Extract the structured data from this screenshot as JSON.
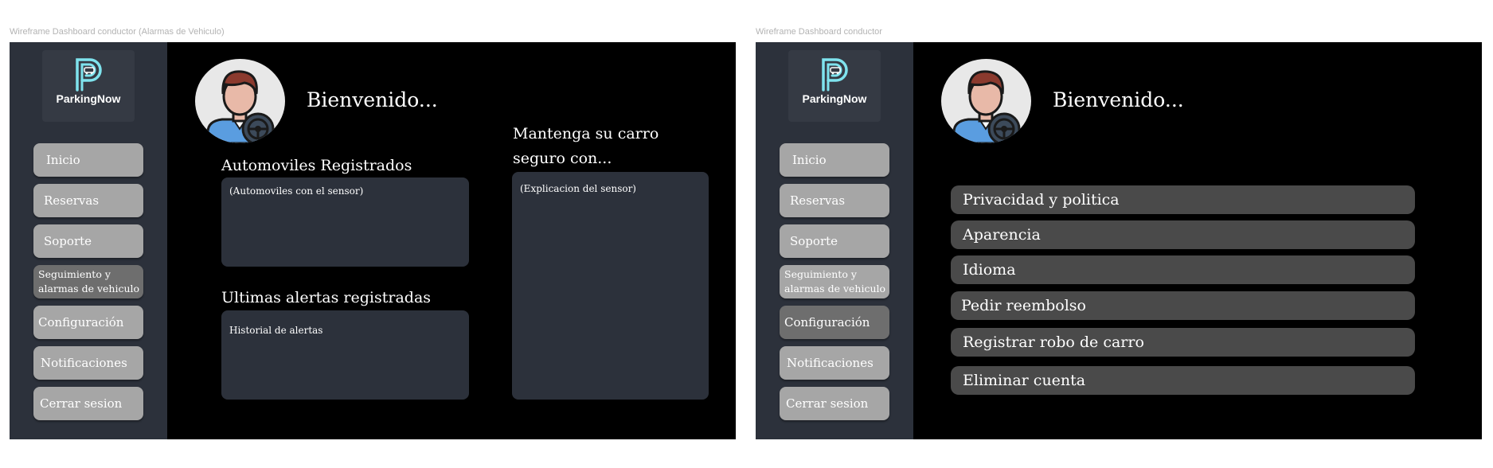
{
  "frames": [
    {
      "title": "Wireframe Dashboard conductor (Alarmas de Vehiculo)",
      "logo_text": "ParkingNow",
      "nav": [
        {
          "label": "Inicio"
        },
        {
          "label": "Reservas"
        },
        {
          "label": "Soporte"
        },
        {
          "label": "Seguimiento y alarmas de vehiculo",
          "active": true
        },
        {
          "label": "Configuración"
        },
        {
          "label": "Notificaciones"
        },
        {
          "label": "Cerrar sesion"
        }
      ],
      "welcome": "Bienvenido...",
      "cars_title": "Automoviles Registrados",
      "cars_panel_text": "(Automoviles con el sensor)",
      "alerts_title": "Ultimas alertas registradas",
      "alerts_panel_text": "Historial de alertas",
      "sensor_title": "Mantenga su carro seguro con...",
      "sensor_panel_text": "(Explicacion del sensor)"
    },
    {
      "title": "Wireframe Dashboard conductor",
      "logo_text": "ParkingNow",
      "nav": [
        {
          "label": "Inicio"
        },
        {
          "label": "Reservas"
        },
        {
          "label": "Soporte"
        },
        {
          "label": "Seguimiento y alarmas de vehiculo"
        },
        {
          "label": "Configuración",
          "active": true
        },
        {
          "label": "Notificaciones"
        },
        {
          "label": "Cerrar sesion"
        }
      ],
      "welcome": "Bienvenido...",
      "options": [
        {
          "label": "Privacidad y politica"
        },
        {
          "label": "Aparencia"
        },
        {
          "label": "Idioma"
        },
        {
          "label": "Pedir reembolso"
        },
        {
          "label": "Registrar robo de carro"
        },
        {
          "label": "Eliminar cuenta"
        }
      ]
    }
  ],
  "colors": {
    "frame_bg": "#000000",
    "sidebar_bg": "#2c313b",
    "nav_button": "#a6a6a6",
    "nav_button_active": "#6e6e6e",
    "panel_bg": "#2c313b",
    "option_button": "#4a4a4a",
    "logo_accent": "#7fe3ee"
  },
  "icons": {
    "logo": "parking-p-car-logo",
    "avatar": "driver-with-steering-wheel-avatar"
  }
}
